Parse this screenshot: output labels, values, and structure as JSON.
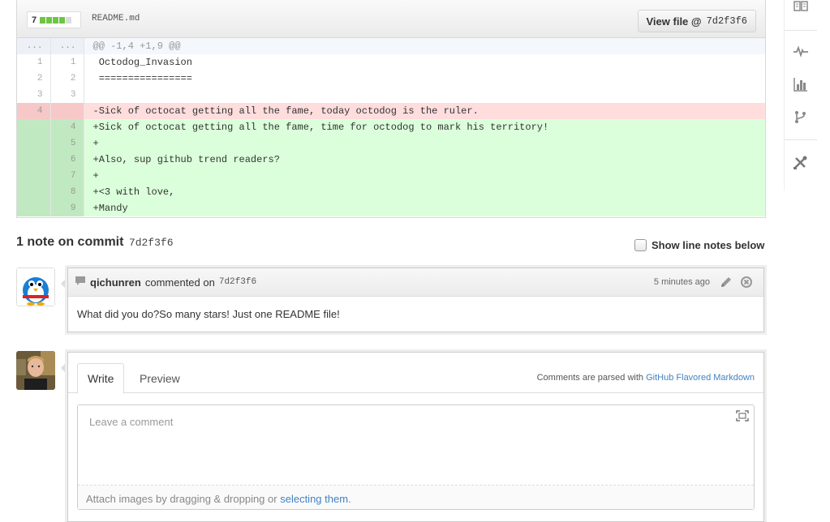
{
  "file": {
    "diffstat_count": "7",
    "filename": "README.md",
    "view_label": "View file @",
    "view_sha": "7d2f3f6"
  },
  "diff": {
    "hunk_old": "...",
    "hunk_new": "...",
    "hunk_header": "@@ -1,4 +1,9 @@",
    "lines": [
      {
        "type": "ctx",
        "old": "1",
        "new": "1",
        "text": " Octodog_Invasion"
      },
      {
        "type": "ctx",
        "old": "2",
        "new": "2",
        "text": " ================"
      },
      {
        "type": "ctx",
        "old": "3",
        "new": "3",
        "text": ""
      },
      {
        "type": "del",
        "old": "4",
        "new": "",
        "text": "-Sick of octocat getting all the fame, today octodog is the ruler."
      },
      {
        "type": "add",
        "old": "",
        "new": "4",
        "text": "+Sick of octocat getting all the fame, time for octodog to mark his territory!"
      },
      {
        "type": "add",
        "old": "",
        "new": "5",
        "text": "+"
      },
      {
        "type": "add",
        "old": "",
        "new": "6",
        "text": "+Also, sup github trend readers?"
      },
      {
        "type": "add",
        "old": "",
        "new": "7",
        "text": "+"
      },
      {
        "type": "add",
        "old": "",
        "new": "8",
        "text": "+<3 with love,"
      },
      {
        "type": "add",
        "old": "",
        "new": "9",
        "text": "+Mandy"
      }
    ]
  },
  "notes": {
    "title": "1 note on commit",
    "sha": "7d2f3f6",
    "show_line_notes": "Show line notes below"
  },
  "comment": {
    "author": "qichunren",
    "action": "commented on",
    "sha": "7d2f3f6",
    "time": "5 minutes ago",
    "body": "What did you do?So many stars! Just one README file!"
  },
  "form": {
    "tab_write": "Write",
    "tab_preview": "Preview",
    "md_note": "Comments are parsed with",
    "md_link": "GitHub Flavored Markdown",
    "placeholder": "Leave a comment",
    "drop_text": "Attach images by dragging & dropping or",
    "drop_link": "selecting them",
    "drop_end": "."
  },
  "sidebar": {
    "icons": [
      "book-icon",
      "pulse-icon",
      "graph-icon",
      "network-icon",
      "settings-icon"
    ]
  },
  "colors": {
    "addition_bg": "#dbffdb",
    "deletion_bg": "#ffdddd",
    "link": "#4183c4",
    "diffstat_green": "#6cc644"
  }
}
